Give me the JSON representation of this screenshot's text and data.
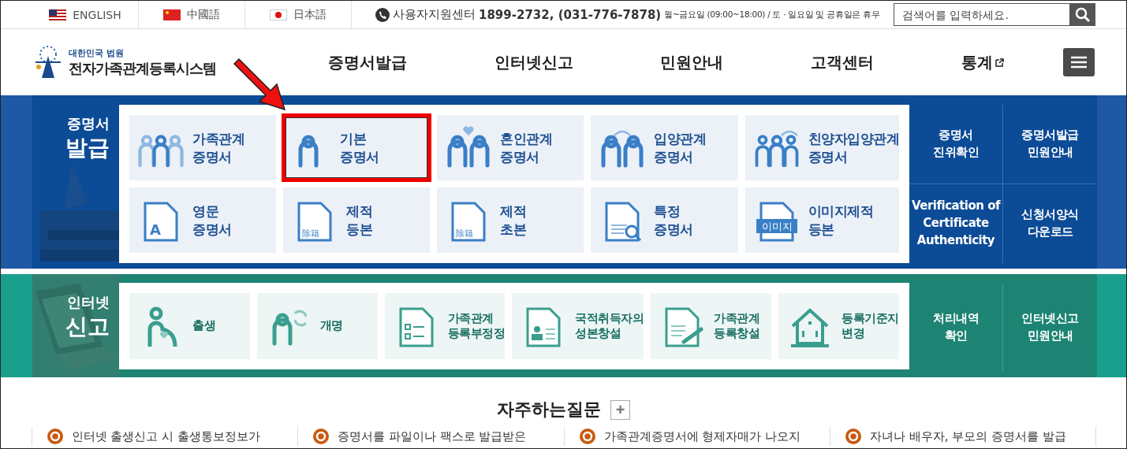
{
  "top_bar": {
    "languages": [
      {
        "label": "ENGLISH"
      },
      {
        "label": "中國語"
      },
      {
        "label": "日本語"
      }
    ],
    "support": {
      "label": "사용자지원센터",
      "phone": "1899-2732, (031-776-7878)",
      "hours": "월~금요일 (09:00~18:00) / 토 · 일요일 및 공휴일은 휴무"
    },
    "search": {
      "placeholder": "검색어를 입력하세요."
    }
  },
  "header": {
    "logo": {
      "subtitle": "대한민국 법원",
      "title": "전자가족관계등록시스템"
    },
    "nav": [
      {
        "label": "증명서발급",
        "external": false
      },
      {
        "label": "인터넷신고",
        "external": false
      },
      {
        "label": "민원안내",
        "external": false
      },
      {
        "label": "고객센터",
        "external": false
      },
      {
        "label": "통계",
        "external": true
      }
    ]
  },
  "certificate_section": {
    "label": [
      "증명서",
      "발급"
    ],
    "tiles": [
      {
        "lines": [
          "가족관계",
          "증명서"
        ],
        "highlighted": false
      },
      {
        "lines": [
          "기본",
          "증명서"
        ],
        "highlighted": true
      },
      {
        "lines": [
          "혼인관계",
          "증명서"
        ],
        "highlighted": false
      },
      {
        "lines": [
          "입양관계",
          "증명서"
        ],
        "highlighted": false
      },
      {
        "lines": [
          "친양자입양관계",
          "증명서"
        ],
        "highlighted": false
      },
      {
        "icon_text": "A",
        "lines": [
          "영문",
          "증명서"
        ],
        "highlighted": false
      },
      {
        "icon_text": "除籍",
        "lines": [
          "제적",
          "등본"
        ],
        "highlighted": false
      },
      {
        "icon_text": "除籍",
        "lines": [
          "제적",
          "초본"
        ],
        "highlighted": false
      },
      {
        "lines": [
          "특정",
          "증명서"
        ],
        "highlighted": false
      },
      {
        "icon_text": "이미지",
        "lines": [
          "이미지제적",
          "등본"
        ],
        "highlighted": false
      }
    ],
    "links": [
      [
        "증명서",
        "진위확인"
      ],
      [
        "증명서발급",
        "민원안내"
      ],
      [
        "Verification of",
        "Certificate",
        "Authenticity"
      ],
      [
        "신청서양식",
        "다운로드"
      ]
    ]
  },
  "annotation_arrow": true,
  "report_section": {
    "label": [
      "인터넷",
      "신고"
    ],
    "tiles": [
      {
        "lines": [
          "출생"
        ]
      },
      {
        "lines": [
          "개명"
        ]
      },
      {
        "lines": [
          "가족관계",
          "등록부정정"
        ]
      },
      {
        "lines": [
          "국적취득자의",
          "성본창설"
        ]
      },
      {
        "lines": [
          "가족관계",
          "등록창설"
        ]
      },
      {
        "lines": [
          "등록기준지",
          "변경"
        ]
      }
    ],
    "links": [
      [
        "처리내역",
        "확인"
      ],
      [
        "인터넷신고",
        "민원안내"
      ]
    ]
  },
  "faq": {
    "title": "자주하는질문",
    "more_button": "+",
    "items": [
      "인터넷 출생신고 시 출생통보정보가",
      "증명서를 파일이나 팩스로 발급받은",
      "가족관계증명서에 형제자매가 나오지",
      "자녀나 배우자, 부모의 증명서를 발급"
    ]
  }
}
